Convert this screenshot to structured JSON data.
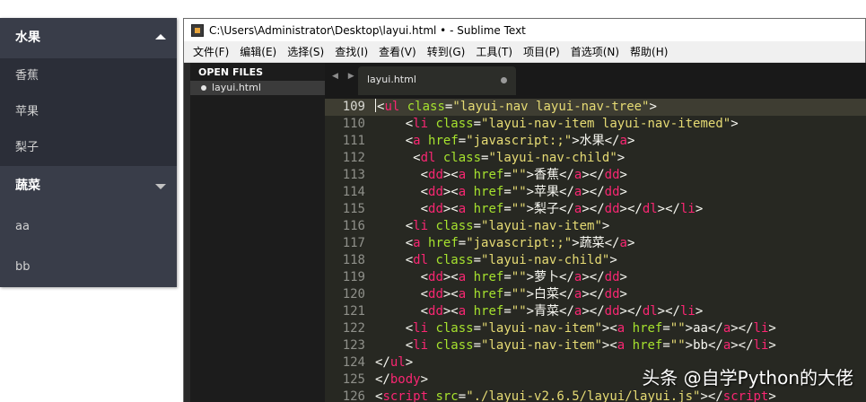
{
  "nav": {
    "groups": [
      {
        "label": "水果",
        "expanded": true,
        "children": [
          "香蕉",
          "苹果",
          "梨子"
        ]
      },
      {
        "label": "蔬菜",
        "expanded": false,
        "children": [
          "aa",
          "bb"
        ]
      }
    ]
  },
  "window": {
    "title": "C:\\Users\\Administrator\\Desktop\\layui.html • - Sublime Text",
    "menu": [
      "文件(F)",
      "编辑(E)",
      "选择(S)",
      "查找(I)",
      "查看(V)",
      "转到(G)",
      "工具(T)",
      "项目(P)",
      "首选项(N)",
      "帮助(H)"
    ],
    "sidebar": {
      "heading": "OPEN FILES",
      "file": "layui.html"
    },
    "tab": {
      "label": "layui.html",
      "arrows": "◀ ▶"
    }
  },
  "colors": {
    "tag": "#f92672",
    "attr": "#a6e22e",
    "string": "#e6db74",
    "text": "#f8f8f2",
    "nav_bg": "#393d49",
    "editor_bg": "#272822"
  },
  "editor": {
    "current_line": 109,
    "lines": [
      {
        "num": "109",
        "tokens": [
          [
            "p",
            "<"
          ],
          [
            "t",
            "ul"
          ],
          [
            "p",
            " "
          ],
          [
            "a",
            "class"
          ],
          [
            "p",
            "="
          ],
          [
            "s",
            "\"layui-nav layui-nav-tree\""
          ],
          [
            "p",
            ">"
          ]
        ]
      },
      {
        "num": "110",
        "tokens": [
          [
            "p",
            "    <"
          ],
          [
            "t",
            "li"
          ],
          [
            "p",
            " "
          ],
          [
            "a",
            "class"
          ],
          [
            "p",
            "="
          ],
          [
            "s",
            "\"layui-nav-item layui-nav-itemed\""
          ],
          [
            "p",
            ">"
          ]
        ]
      },
      {
        "num": "111",
        "tokens": [
          [
            "p",
            "    <"
          ],
          [
            "t",
            "a"
          ],
          [
            "p",
            " "
          ],
          [
            "a",
            "href"
          ],
          [
            "p",
            "="
          ],
          [
            "s",
            "\"javascript:;\""
          ],
          [
            "p",
            ">水果</"
          ],
          [
            "t",
            "a"
          ],
          [
            "p",
            ">"
          ]
        ]
      },
      {
        "num": "112",
        "tokens": [
          [
            "p",
            "     <"
          ],
          [
            "t",
            "dl"
          ],
          [
            "p",
            " "
          ],
          [
            "a",
            "class"
          ],
          [
            "p",
            "="
          ],
          [
            "s",
            "\"layui-nav-child\""
          ],
          [
            "p",
            ">"
          ]
        ]
      },
      {
        "num": "113",
        "tokens": [
          [
            "p",
            "      <"
          ],
          [
            "t",
            "dd"
          ],
          [
            "p",
            "><"
          ],
          [
            "t",
            "a"
          ],
          [
            "p",
            " "
          ],
          [
            "a",
            "href"
          ],
          [
            "p",
            "="
          ],
          [
            "s",
            "\"\""
          ],
          [
            "p",
            ">香蕉</"
          ],
          [
            "t",
            "a"
          ],
          [
            "p",
            "></"
          ],
          [
            "t",
            "dd"
          ],
          [
            "p",
            ">"
          ]
        ]
      },
      {
        "num": "114",
        "tokens": [
          [
            "p",
            "      <"
          ],
          [
            "t",
            "dd"
          ],
          [
            "p",
            "><"
          ],
          [
            "t",
            "a"
          ],
          [
            "p",
            " "
          ],
          [
            "a",
            "href"
          ],
          [
            "p",
            "="
          ],
          [
            "s",
            "\"\""
          ],
          [
            "p",
            ">苹果</"
          ],
          [
            "t",
            "a"
          ],
          [
            "p",
            "></"
          ],
          [
            "t",
            "dd"
          ],
          [
            "p",
            ">"
          ]
        ]
      },
      {
        "num": "115",
        "tokens": [
          [
            "p",
            "      <"
          ],
          [
            "t",
            "dd"
          ],
          [
            "p",
            "><"
          ],
          [
            "t",
            "a"
          ],
          [
            "p",
            " "
          ],
          [
            "a",
            "href"
          ],
          [
            "p",
            "="
          ],
          [
            "s",
            "\"\""
          ],
          [
            "p",
            ">梨子</"
          ],
          [
            "t",
            "a"
          ],
          [
            "p",
            "></"
          ],
          [
            "t",
            "dd"
          ],
          [
            "p",
            "></"
          ],
          [
            "t",
            "dl"
          ],
          [
            "p",
            "></"
          ],
          [
            "t",
            "li"
          ],
          [
            "p",
            ">"
          ]
        ]
      },
      {
        "num": "116",
        "tokens": [
          [
            "p",
            "    <"
          ],
          [
            "t",
            "li"
          ],
          [
            "p",
            " "
          ],
          [
            "a",
            "class"
          ],
          [
            "p",
            "="
          ],
          [
            "s",
            "\"layui-nav-item\""
          ],
          [
            "p",
            ">"
          ]
        ]
      },
      {
        "num": "117",
        "tokens": [
          [
            "p",
            "    <"
          ],
          [
            "t",
            "a"
          ],
          [
            "p",
            " "
          ],
          [
            "a",
            "href"
          ],
          [
            "p",
            "="
          ],
          [
            "s",
            "\"javascript:;\""
          ],
          [
            "p",
            ">蔬菜</"
          ],
          [
            "t",
            "a"
          ],
          [
            "p",
            ">"
          ]
        ]
      },
      {
        "num": "118",
        "tokens": [
          [
            "p",
            "    <"
          ],
          [
            "t",
            "dl"
          ],
          [
            "p",
            " "
          ],
          [
            "a",
            "class"
          ],
          [
            "p",
            "="
          ],
          [
            "s",
            "\"layui-nav-child\""
          ],
          [
            "p",
            ">"
          ]
        ]
      },
      {
        "num": "119",
        "tokens": [
          [
            "p",
            "      <"
          ],
          [
            "t",
            "dd"
          ],
          [
            "p",
            "><"
          ],
          [
            "t",
            "a"
          ],
          [
            "p",
            " "
          ],
          [
            "a",
            "href"
          ],
          [
            "p",
            "="
          ],
          [
            "s",
            "\"\""
          ],
          [
            "p",
            ">萝卜</"
          ],
          [
            "t",
            "a"
          ],
          [
            "p",
            "></"
          ],
          [
            "t",
            "dd"
          ],
          [
            "p",
            ">"
          ]
        ]
      },
      {
        "num": "120",
        "tokens": [
          [
            "p",
            "      <"
          ],
          [
            "t",
            "dd"
          ],
          [
            "p",
            "><"
          ],
          [
            "t",
            "a"
          ],
          [
            "p",
            " "
          ],
          [
            "a",
            "href"
          ],
          [
            "p",
            "="
          ],
          [
            "s",
            "\"\""
          ],
          [
            "p",
            ">白菜</"
          ],
          [
            "t",
            "a"
          ],
          [
            "p",
            "></"
          ],
          [
            "t",
            "dd"
          ],
          [
            "p",
            ">"
          ]
        ]
      },
      {
        "num": "121",
        "tokens": [
          [
            "p",
            "      <"
          ],
          [
            "t",
            "dd"
          ],
          [
            "p",
            "><"
          ],
          [
            "t",
            "a"
          ],
          [
            "p",
            " "
          ],
          [
            "a",
            "href"
          ],
          [
            "p",
            "="
          ],
          [
            "s",
            "\"\""
          ],
          [
            "p",
            ">青菜</"
          ],
          [
            "t",
            "a"
          ],
          [
            "p",
            "></"
          ],
          [
            "t",
            "dd"
          ],
          [
            "p",
            "></"
          ],
          [
            "t",
            "dl"
          ],
          [
            "p",
            "></"
          ],
          [
            "t",
            "li"
          ],
          [
            "p",
            ">"
          ]
        ]
      },
      {
        "num": "122",
        "tokens": [
          [
            "p",
            "    <"
          ],
          [
            "t",
            "li"
          ],
          [
            "p",
            " "
          ],
          [
            "a",
            "class"
          ],
          [
            "p",
            "="
          ],
          [
            "s",
            "\"layui-nav-item\""
          ],
          [
            "p",
            "><"
          ],
          [
            "t",
            "a"
          ],
          [
            "p",
            " "
          ],
          [
            "a",
            "href"
          ],
          [
            "p",
            "="
          ],
          [
            "s",
            "\"\""
          ],
          [
            "p",
            ">aa</"
          ],
          [
            "t",
            "a"
          ],
          [
            "p",
            "></"
          ],
          [
            "t",
            "li"
          ],
          [
            "p",
            ">"
          ]
        ]
      },
      {
        "num": "123",
        "tokens": [
          [
            "p",
            "    <"
          ],
          [
            "t",
            "li"
          ],
          [
            "p",
            " "
          ],
          [
            "a",
            "class"
          ],
          [
            "p",
            "="
          ],
          [
            "s",
            "\"layui-nav-item\""
          ],
          [
            "p",
            "><"
          ],
          [
            "t",
            "a"
          ],
          [
            "p",
            " "
          ],
          [
            "a",
            "href"
          ],
          [
            "p",
            "="
          ],
          [
            "s",
            "\"\""
          ],
          [
            "p",
            ">bb</"
          ],
          [
            "t",
            "a"
          ],
          [
            "p",
            "></"
          ],
          [
            "t",
            "li"
          ],
          [
            "p",
            ">"
          ]
        ]
      },
      {
        "num": "124",
        "tokens": [
          [
            "p",
            "</"
          ],
          [
            "t",
            "ul"
          ],
          [
            "p",
            ">"
          ]
        ]
      },
      {
        "num": "125",
        "tokens": [
          [
            "p",
            "</"
          ],
          [
            "t",
            "body"
          ],
          [
            "p",
            ">"
          ]
        ]
      },
      {
        "num": "126",
        "tokens": [
          [
            "p",
            "<"
          ],
          [
            "t",
            "script"
          ],
          [
            "p",
            " "
          ],
          [
            "a",
            "src"
          ],
          [
            "p",
            "="
          ],
          [
            "s",
            "\"./layui-v2.6.5/layui/layui.js\""
          ],
          [
            "p",
            "></"
          ],
          [
            "t",
            "script"
          ],
          [
            "p",
            ">"
          ]
        ]
      }
    ]
  },
  "watermark": "头条 @自学Python的大佬"
}
